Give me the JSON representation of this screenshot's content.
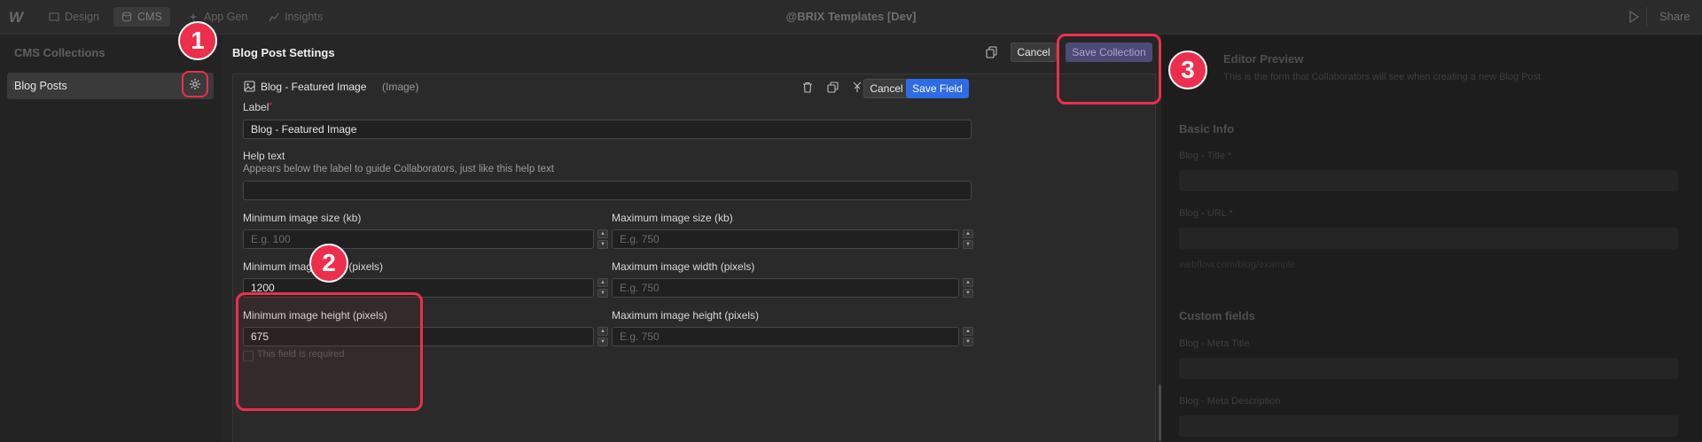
{
  "topbar": {
    "logo": "W",
    "tabs": [
      {
        "label": "Design",
        "icon": "design-icon"
      },
      {
        "label": "CMS",
        "icon": "database-icon"
      },
      {
        "label": "App Gen",
        "icon": "sparkle-icon"
      },
      {
        "label": "Insights",
        "icon": "chart-icon"
      }
    ],
    "site_title": "@BRIX Templates [Dev]",
    "share_label": "Share"
  },
  "sidebar": {
    "title": "CMS Collections",
    "items": [
      {
        "label": "Blog Posts"
      }
    ]
  },
  "settings": {
    "title": "Blog Post Settings",
    "cancel_label": "Cancel",
    "save_collection_label": "Save Collection"
  },
  "field": {
    "name": "Blog - Featured Image",
    "type": "(Image)",
    "cancel_label": "Cancel",
    "save_label": "Save Field",
    "label_caption": "Label",
    "label_value": "Blog - Featured Image",
    "help_caption": "Help text",
    "help_hint": "Appears below the label to guide Collaborators, just like this help text",
    "help_value": "",
    "min_size_caption": "Minimum image size (kb)",
    "min_size_placeholder": "E.g. 100",
    "max_size_caption": "Maximum image size (kb)",
    "max_size_placeholder": "E.g. 750",
    "min_width_caption": "Minimum image width (pixels)",
    "min_width_value": "1200",
    "max_width_caption": "Maximum image width (pixels)",
    "max_width_placeholder": "E.g. 750",
    "min_height_caption": "Minimum image height (pixels)",
    "min_height_value": "675",
    "max_height_caption": "Maximum image height (pixels)",
    "max_height_placeholder": "E.g. 750",
    "required_label": "This field is required"
  },
  "preview": {
    "title": "Editor Preview",
    "subtitle": "This is the form that Collaborators will see when creating a new Blog Post",
    "basic_info": "Basic Info",
    "blog_title": "Blog - Title *",
    "blog_url": "Blog - URL *",
    "url_hint": "webflow.com/blog/example",
    "custom_fields": "Custom fields",
    "meta_title": "Blog - Meta Title",
    "meta_description": "Blog - Meta Description"
  },
  "annotations": [
    "1",
    "2",
    "3"
  ],
  "colors": {
    "accent_red": "#ee2e4c",
    "primary_blue": "#2d6ce5",
    "save_collection_bg": "#4e4a77"
  }
}
